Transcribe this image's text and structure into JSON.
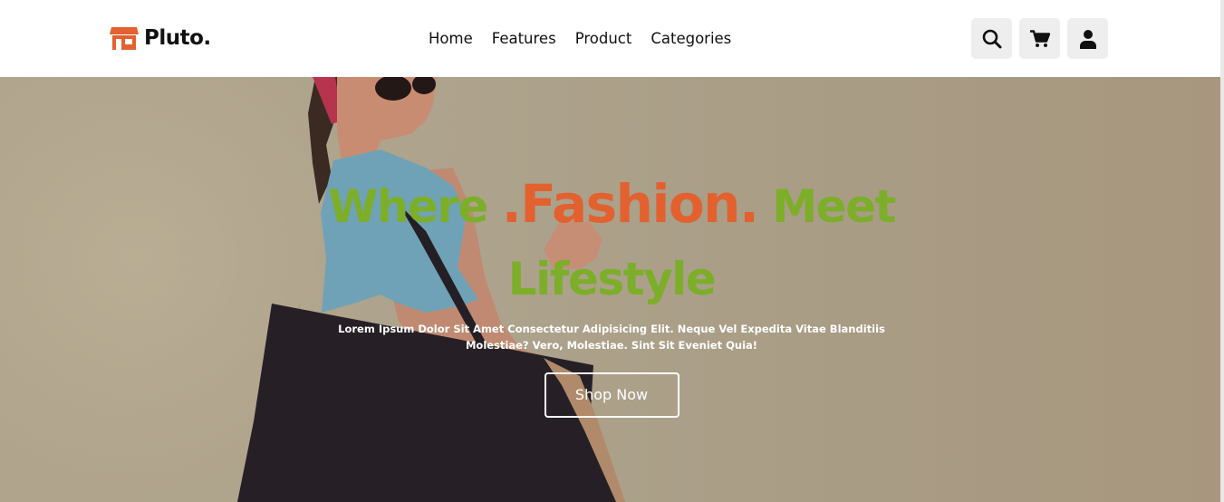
{
  "brand": {
    "name": "Pluto.",
    "icon": "shop-icon",
    "accent": "#e2612f"
  },
  "nav": {
    "items": [
      "Home",
      "Features",
      "Product",
      "Categories"
    ]
  },
  "header_icons": [
    "search-icon",
    "cart-icon",
    "user-icon"
  ],
  "hero": {
    "title_part1": "Where ",
    "title_highlight": ".Fashion.",
    "title_part2": " Meet Lifestyle",
    "text": "Lorem Ipsum Dolor Sit Amet Consectetur Adipisicing Elit. Neque Vel Expedita Vitae Blanditiis Molestiae? Vero, Molestiae. Sint Sit Eveniet Quia!",
    "cta": "Shop Now",
    "title_green": "#7cae2a",
    "title_orange": "#e2612f"
  }
}
